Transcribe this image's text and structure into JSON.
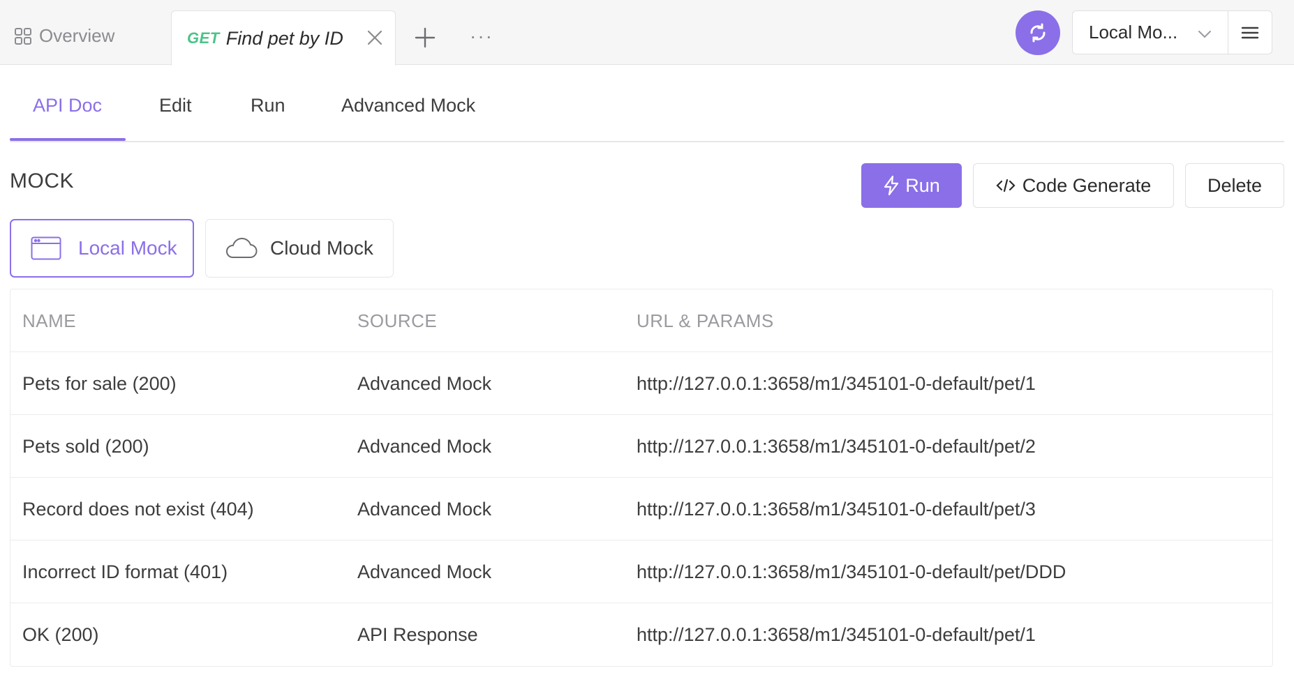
{
  "tabbar": {
    "overview_label": "Overview",
    "active_tab": {
      "method": "GET",
      "title": "Find pet by ID"
    },
    "more_label": "···",
    "environment": "Local Mo..."
  },
  "subtabs": [
    "API Doc",
    "Edit",
    "Run",
    "Advanced Mock"
  ],
  "section": {
    "title": "MOCK",
    "run_label": "Run",
    "code_label": "Code Generate",
    "delete_label": "Delete"
  },
  "mock_types": {
    "local": "Local Mock",
    "cloud": "Cloud Mock",
    "selected": "Local Mock"
  },
  "table": {
    "headers": [
      "NAME",
      "SOURCE",
      "URL & PARAMS"
    ],
    "rows": [
      {
        "name": "Pets for sale (200)",
        "source": "Advanced Mock",
        "url": "http://127.0.0.1:3658/m1/345101-0-default/pet/1"
      },
      {
        "name": "Pets sold (200)",
        "source": "Advanced Mock",
        "url": "http://127.0.0.1:3658/m1/345101-0-default/pet/2"
      },
      {
        "name": "Record does not exist (404)",
        "source": "Advanced Mock",
        "url": "http://127.0.0.1:3658/m1/345101-0-default/pet/3"
      },
      {
        "name": "Incorrect ID format (401)",
        "source": "Advanced Mock",
        "url": "http://127.0.0.1:3658/m1/345101-0-default/pet/DDD"
      },
      {
        "name": "OK (200)",
        "source": "API Response",
        "url": "http://127.0.0.1:3658/m1/345101-0-default/pet/1"
      }
    ]
  },
  "colors": {
    "accent": "#8b6fe8",
    "get_method": "#4cc38a"
  },
  "icons": [
    "grid-icon",
    "close-icon",
    "plus-icon",
    "sync-icon",
    "chevron-down-icon",
    "hamburger-menu-icon",
    "lightning-icon",
    "code-icon",
    "browser-window-icon",
    "cloud-icon"
  ]
}
